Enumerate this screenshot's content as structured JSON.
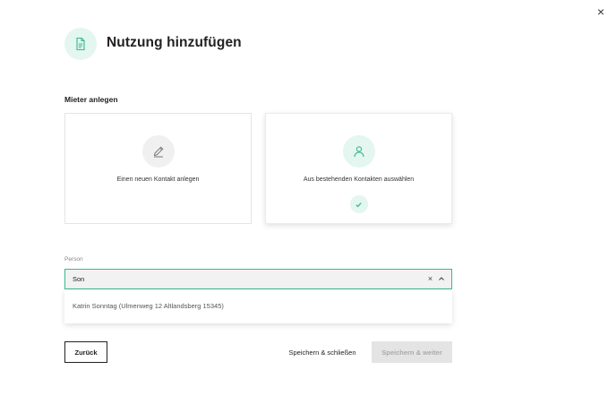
{
  "dialog": {
    "close_label": "×",
    "title": "Nutzung hinzufügen",
    "header_icon": "document-icon",
    "accent_color": "#3ab98a"
  },
  "tenant_section": {
    "title": "Mieter anlegen",
    "options": [
      {
        "label": "Einen neuen Kontakt anlegen",
        "icon": "pencil-icon",
        "selected": false
      },
      {
        "label": "Aus bestehenden Kontakten auswählen",
        "icon": "person-icon",
        "selected": true
      }
    ]
  },
  "person_field": {
    "label": "Person",
    "value": "Son",
    "clear_label": "×",
    "dropdown_open": true,
    "options": [
      "Katrin Sonntag (Ulmenweg 12 Altlandsberg 15345)"
    ]
  },
  "footer": {
    "back_label": "Zurück",
    "save_close_label": "Speichern & schließen",
    "save_next_label": "Speichern & weiter",
    "save_next_disabled": true
  }
}
